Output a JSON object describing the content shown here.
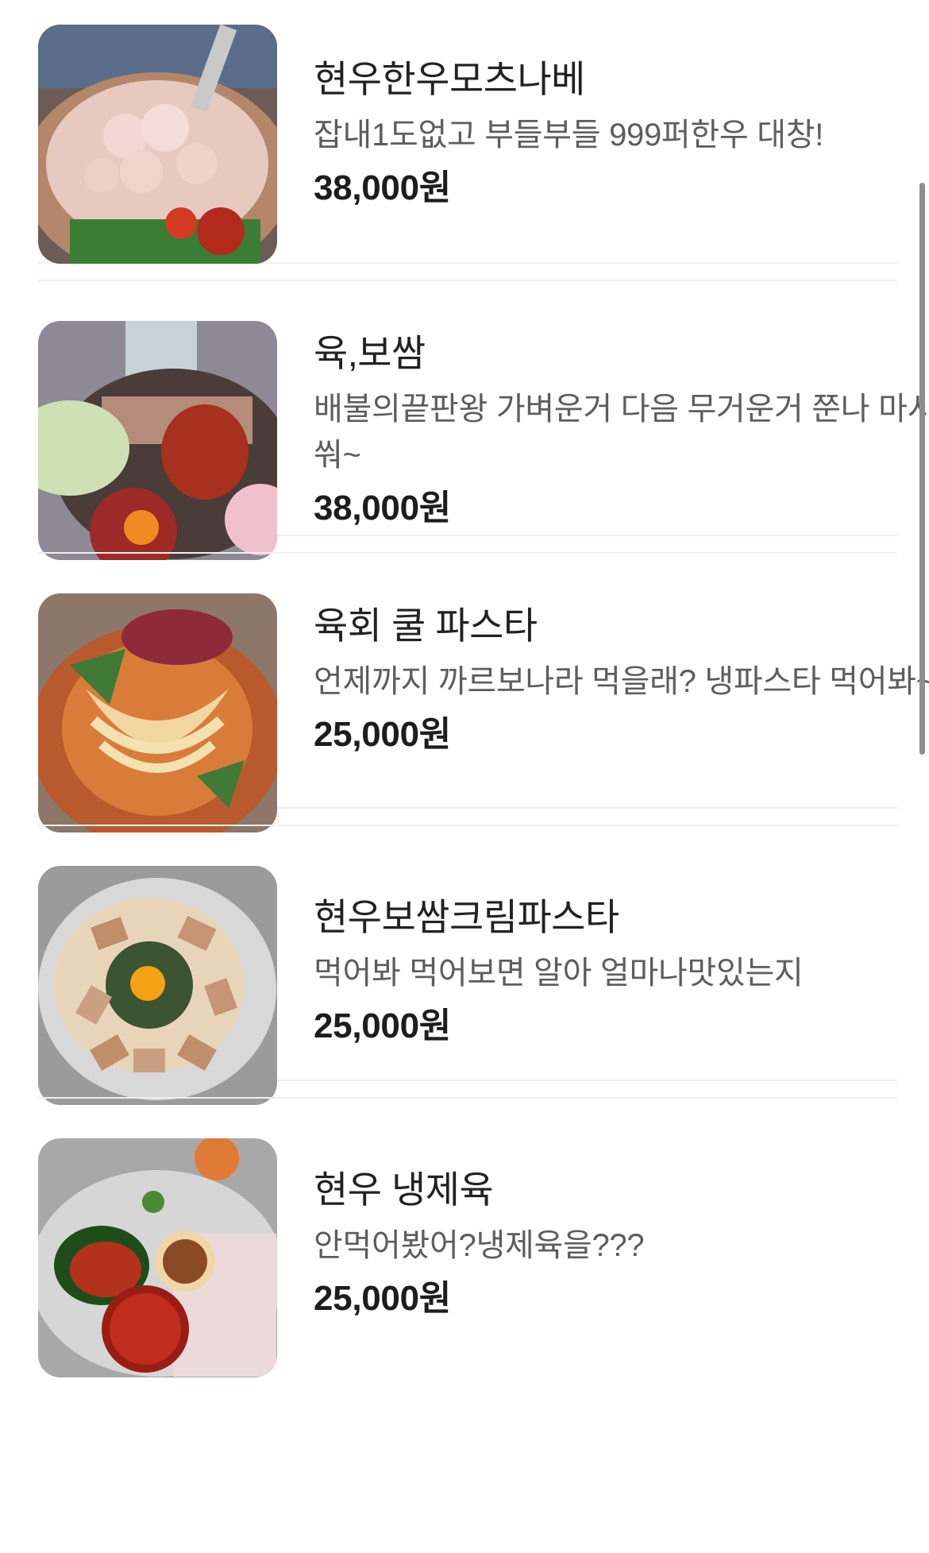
{
  "menu": {
    "items": [
      {
        "name": "현우한우모츠나베",
        "description": "잡내1도없고 부들부들 999퍼한우 대창!",
        "price": "38,000원",
        "image_icon": "food-photo-icon"
      },
      {
        "name": "육,보쌈",
        "description": "배불의끝판왕 가벼운거 다음 무거운거 쭌나 마시쒀~",
        "price": "38,000원",
        "image_icon": "food-photo-icon"
      },
      {
        "name": "육회 쿨 파스타",
        "description": "언제까지 까르보나라 먹을래? 냉파스타 먹어봐~",
        "price": "25,000원",
        "image_icon": "food-photo-icon"
      },
      {
        "name": "현우보쌈크림파스타",
        "description": "먹어봐 먹어보면 알아 얼마나맛있는지",
        "price": "25,000원",
        "image_icon": "food-photo-icon"
      },
      {
        "name": "현우 냉제육",
        "description": "안먹어봤어?냉제육을???",
        "price": "25,000원",
        "image_icon": "food-photo-icon"
      }
    ]
  },
  "colors": {
    "name_text": "#222222",
    "description_text": "#5d5d5d",
    "price_text": "#1d1d1d",
    "divider": "#efefef",
    "scrollbar": "#8e8e8e"
  }
}
